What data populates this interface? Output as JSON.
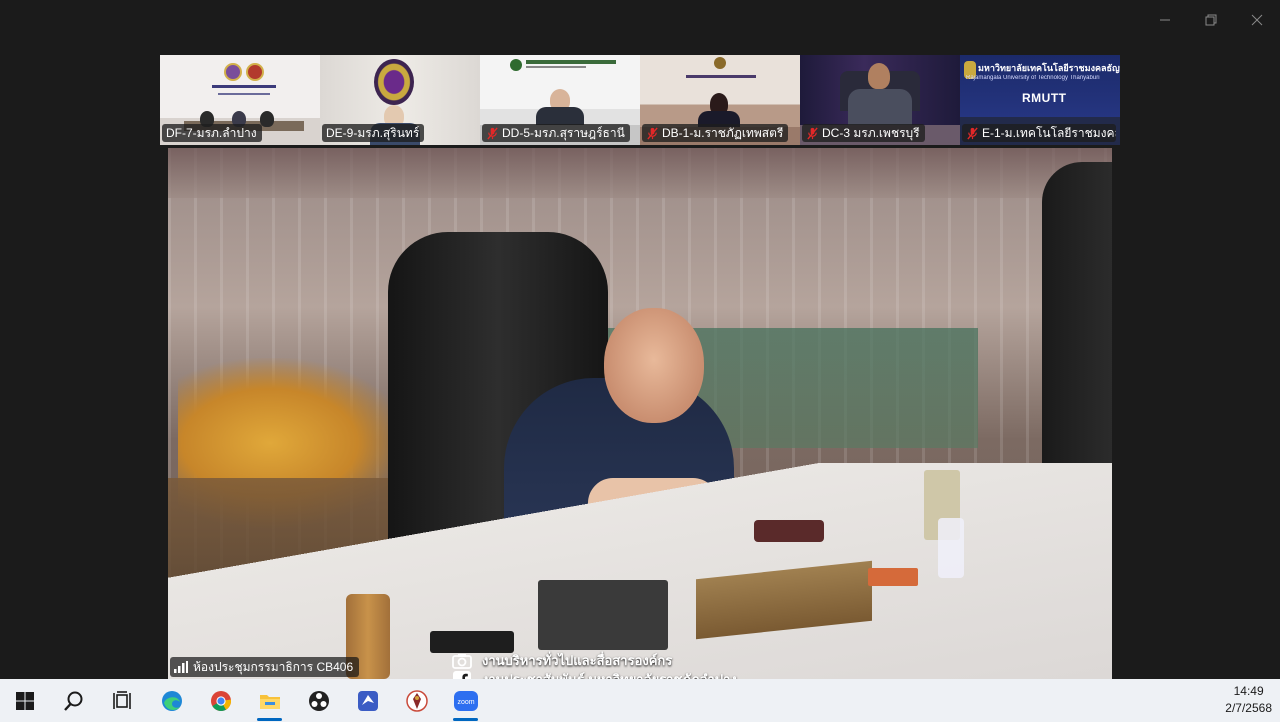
{
  "window": {
    "minimize_icon": "minimize-icon",
    "restore_icon": "restore-icon",
    "close_icon": "close-icon"
  },
  "gallery": [
    {
      "label": "DF-7-มรภ.ลำปาง",
      "muted": false
    },
    {
      "label": "DE-9-มรภ.สุรินทร์",
      "muted": false
    },
    {
      "label": "DD-5-มรภ.สุราษฎร์ธานี",
      "muted": true
    },
    {
      "label": "DB-1-ม.ราชภัฏเทพสตรี",
      "muted": true
    },
    {
      "label": "DC-3 มรภ.เพชรบุรี",
      "muted": true
    },
    {
      "label": "E-1-ม.เทคโนโลยีราชมงคล...",
      "muted": true
    }
  ],
  "tile5_text": {
    "title": "มหาวิทยาลัยเทคโนโลยีราชมงคลธัญบุรี",
    "subtitle": "Rajamangala University of Technology Thanyaburi",
    "logo": "RMUTT"
  },
  "main": {
    "room_label": "ห้องประชุมกรรมาธิการ CB406",
    "credit_line1": "งานบริหารทั่วไปและสื่อสารองค์กร",
    "credit_line2": "งานประชาสัมพันธ์ มหาวิทยาลัยราชภัฏลำปาง"
  },
  "taskbar": {
    "items": [
      "windows-start-icon",
      "search-icon",
      "task-view-icon",
      "edge-icon",
      "chrome-icon",
      "file-explorer-icon",
      "obs-icon",
      "app-icon",
      "emblem-app-icon",
      "zoom-icon"
    ],
    "zoom_label": "zoom",
    "time": "14:49",
    "date": "2/7/2568"
  },
  "colors": {
    "taskbar_bg": "#eef1f5",
    "accent": "#0067c0",
    "muted_red": "#e02828"
  }
}
